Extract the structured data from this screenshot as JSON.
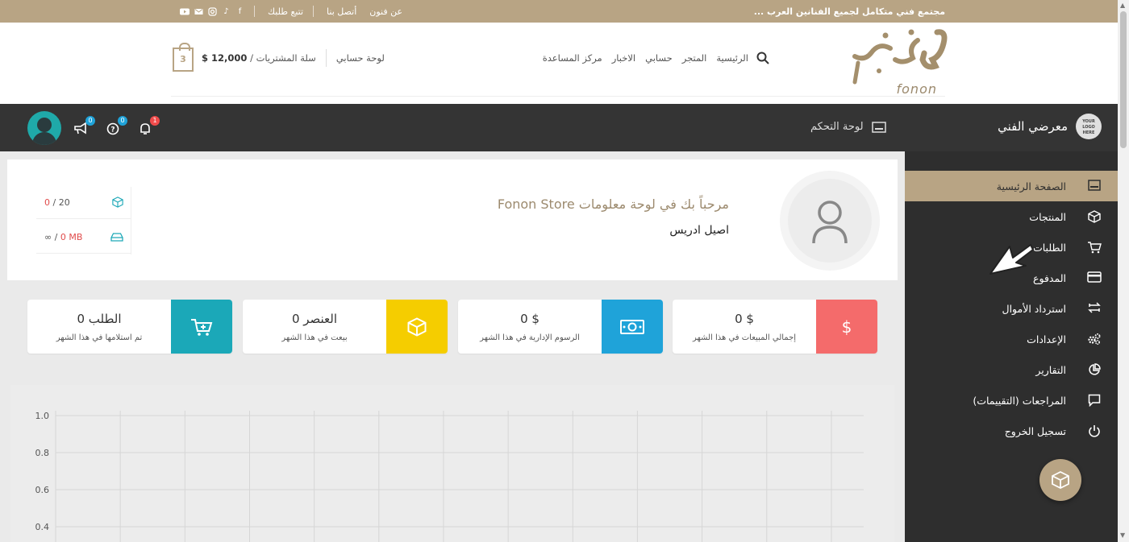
{
  "topbar": {
    "tagline": "مجتمع فني متكامل لجميع الفنانين العرب ...",
    "links": [
      "عن فنون",
      "أتصل بنا",
      "تتبع طلبك"
    ]
  },
  "header": {
    "logo_text": "fonon",
    "nav": [
      "الرئيسية",
      "المتجر",
      "حسابي",
      "الاخبار",
      "مركز المساعدة"
    ],
    "account_link": "لوحة حسابي",
    "cart_label": "سلة المشتريات /",
    "cart_price": "12,000 $",
    "cart_count": "3"
  },
  "dashbar": {
    "brand_name": "معرضي الفني",
    "brand_logo_text": "YOUR LOGO HERE",
    "title": "لوحة التحكم",
    "notifications_count": "1",
    "help_count": "0",
    "announcements_count": "0"
  },
  "sidebar": {
    "items": [
      {
        "label": "الصفحة الرئيسية",
        "icon": "dashboard-icon",
        "active": true
      },
      {
        "label": "المنتجات",
        "icon": "box-icon"
      },
      {
        "label": "الطلبات",
        "icon": "cart-icon"
      },
      {
        "label": "المدفوع",
        "icon": "card-icon"
      },
      {
        "label": "استرداد الأموال",
        "icon": "refund-icon"
      },
      {
        "label": "الإعدادات",
        "icon": "gears-icon"
      },
      {
        "label": "التقارير",
        "icon": "pie-icon"
      },
      {
        "label": "المراجعات (التقييمات)",
        "icon": "comment-icon"
      },
      {
        "label": "تسجيل الخروج",
        "icon": "power-icon"
      }
    ]
  },
  "welcome": {
    "title": "مرحباً بك في لوحة معلومات Fonon Store",
    "name": "اصيل ادريس",
    "products_quota": {
      "used": "0",
      "limit": "20"
    },
    "storage_quota": {
      "used": "0 MB",
      "limit": "∞"
    }
  },
  "stats": [
    {
      "value": "0 $",
      "label": "إجمالي المبيعات في هذا الشهر",
      "color": "#f46b6b",
      "icon": "dollar-icon"
    },
    {
      "value": "0 $",
      "label": "الرسوم الإدارية في هذا الشهر",
      "color": "#1fa3d9",
      "icon": "money-icon"
    },
    {
      "value": "0 العنصر",
      "label": "بيعت في هذا الشهر",
      "color": "#f5cd00",
      "icon": "box-icon"
    },
    {
      "value": "0 الطلب",
      "label": "تم استلامها في هذا الشهر",
      "color": "#1ba8b8",
      "icon": "cart-plus-icon"
    }
  ],
  "chart_data": {
    "type": "line",
    "yticks": [
      "1.0",
      "0.8",
      "0.6",
      "0.4"
    ],
    "ylim": [
      0.4,
      1.0
    ],
    "grid": true,
    "series": []
  }
}
